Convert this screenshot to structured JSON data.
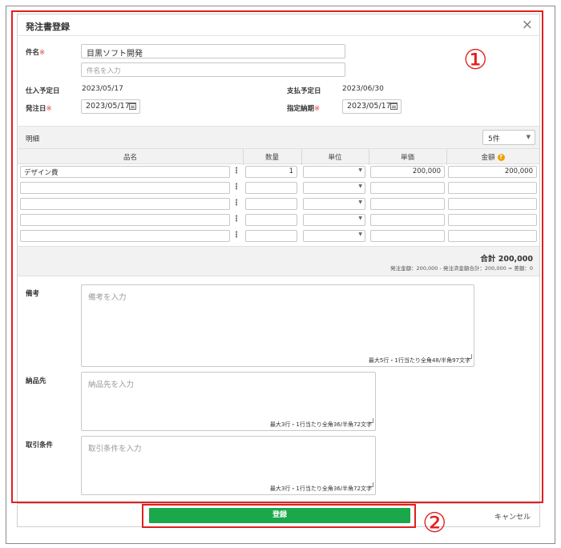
{
  "modal": {
    "title": "発注書登録",
    "close_glyph": "×"
  },
  "form": {
    "subject_label": "件名",
    "required_mark": "※",
    "subject_value": "目黒ソフト開発",
    "subject_sub_placeholder": "件名を入力",
    "receipt_date_label": "仕入予定日",
    "receipt_date_value": "2023/05/17",
    "payment_date_label": "支払予定日",
    "payment_date_value": "2023/06/30",
    "order_date_label": "発注日",
    "order_date_value": "2023/05/17",
    "delivery_date_label": "指定納期",
    "delivery_date_value": "2023/05/17"
  },
  "details": {
    "label": "明細",
    "count_selected": "5件",
    "columns": {
      "item": "品名",
      "qty": "数量",
      "unit": "単位",
      "price": "単価",
      "amount": "金額"
    },
    "rows": [
      {
        "item": "デザイン費",
        "qty": "1",
        "unit": "",
        "price": "200,000",
        "amount": "200,000"
      },
      {
        "item": "",
        "qty": "",
        "unit": "",
        "price": "",
        "amount": ""
      },
      {
        "item": "",
        "qty": "",
        "unit": "",
        "price": "",
        "amount": ""
      },
      {
        "item": "",
        "qty": "",
        "unit": "",
        "price": "",
        "amount": ""
      },
      {
        "item": "",
        "qty": "",
        "unit": "",
        "price": "",
        "amount": ""
      }
    ],
    "total": "合計 200,000",
    "total_breakdown": "発注金額：200,000 - 発注済金額合計：200,000 = 差額：0"
  },
  "notes": {
    "remarks_label": "備考",
    "remarks_placeholder": "備考を入力",
    "remarks_hint": "最大5行・1行当たり全角48/半角97文字",
    "delivery_label": "納品先",
    "delivery_placeholder": "納品先を入力",
    "delivery_hint": "最大3行・1行当たり全角36/半角72文字",
    "terms_label": "取引条件",
    "terms_placeholder": "取引条件を入力",
    "terms_hint": "最大3行・1行当たり全角36/半角72文字"
  },
  "footer": {
    "register_label": "登録",
    "cancel_label": "キャンセル"
  },
  "annotations": {
    "marker_1": "①",
    "marker_2": "②"
  },
  "colors": {
    "accent_green": "#1aa84a",
    "annotation_red": "#e02020",
    "help_orange": "#f0a000"
  }
}
